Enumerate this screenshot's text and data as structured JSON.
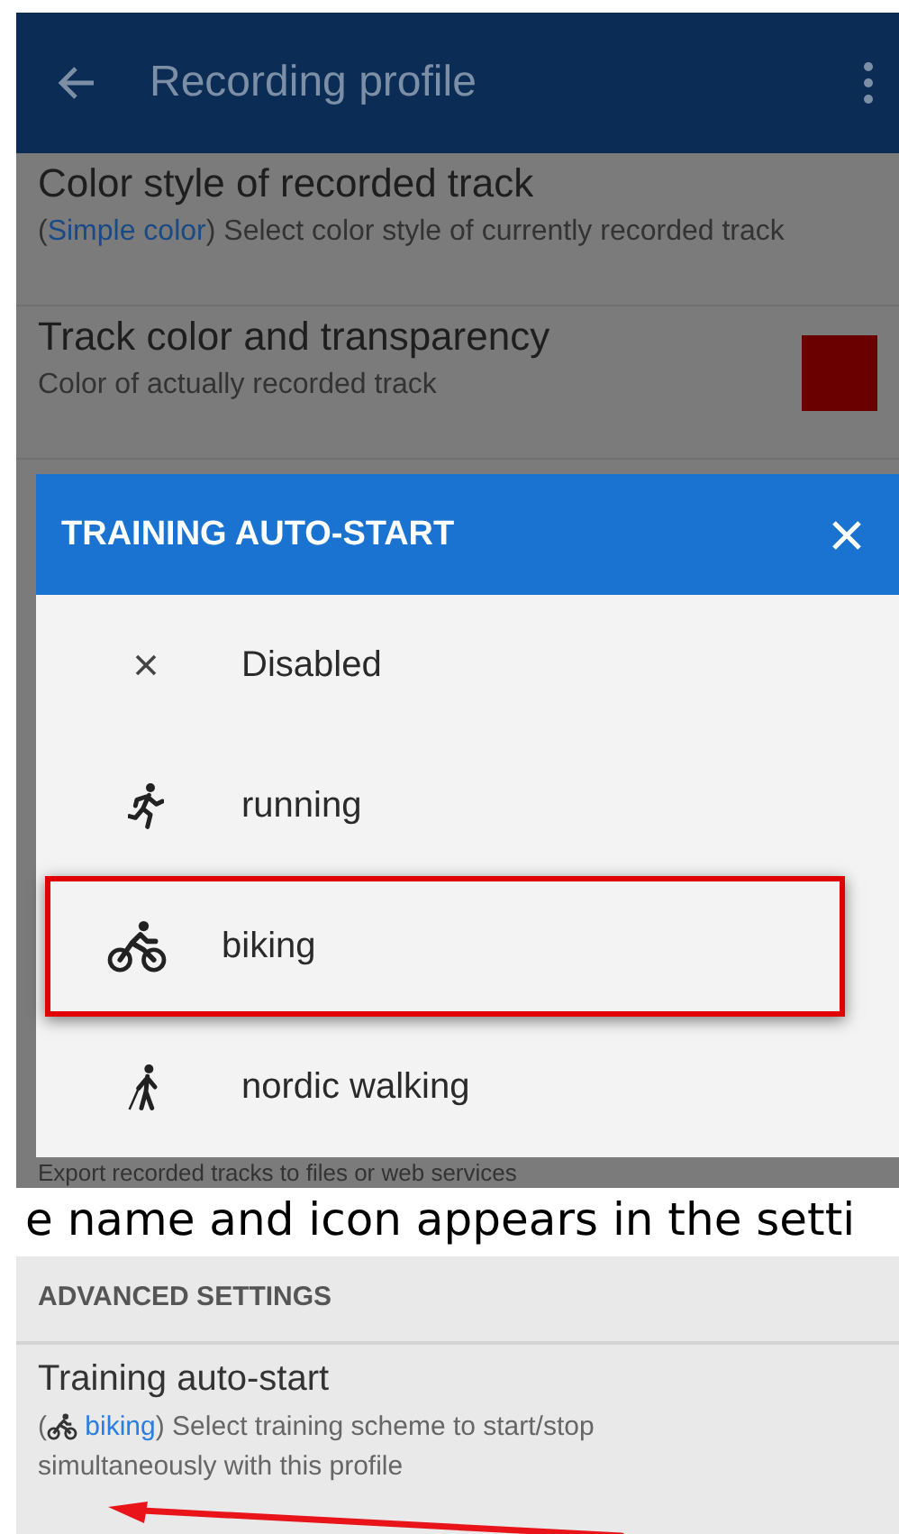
{
  "top_screenshot": {
    "app_bar": {
      "title": "Recording profile"
    },
    "settings": [
      {
        "kind": "text",
        "title": "Color style of recorded track",
        "value_open": "(",
        "value": "Simple color",
        "value_close": ")",
        "description": "Select color style of currently recorded track"
      },
      {
        "kind": "swatch",
        "title": "Track color and transparency",
        "description": "Color of actually recorded track"
      }
    ],
    "dialog": {
      "title": "TRAINING AUTO-START",
      "options": [
        {
          "kind": "none",
          "label": "Disabled",
          "highlighted": false
        },
        {
          "kind": "running",
          "label": "running",
          "highlighted": false
        },
        {
          "kind": "biking",
          "label": "biking",
          "highlighted": true
        },
        {
          "kind": "walking",
          "label": "nordic walking",
          "highlighted": false
        }
      ]
    },
    "behind_text": "Export recorded tracks to files or web services"
  },
  "caption": "e name and icon appears in the setti",
  "bottom_screenshot": {
    "section_header": "ADVANCED SETTINGS",
    "setting": {
      "title": "Training auto-start",
      "value_open": "(",
      "value": "biking",
      "value_close": ")",
      "description": "Select training scheme to start/stop simultaneously with this profile"
    }
  }
}
